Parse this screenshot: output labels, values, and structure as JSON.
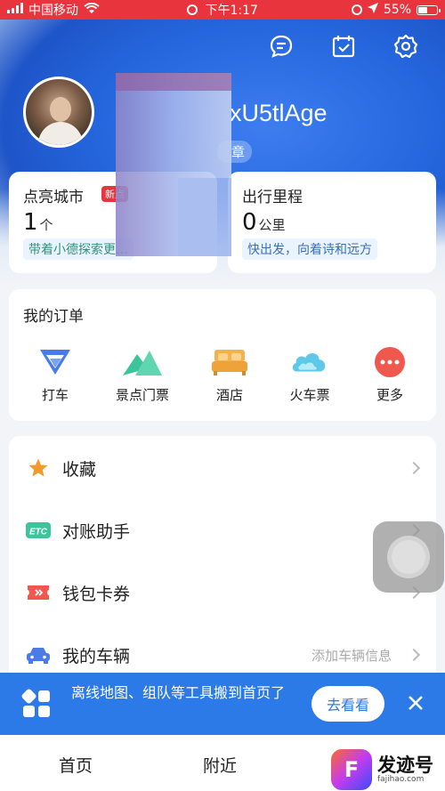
{
  "status_bar": {
    "carrier": "中国移动",
    "time": "下午1:17",
    "battery": "55%",
    "battery_level": 0.55
  },
  "header": {
    "username": "xU5tlAge",
    "badge": "章"
  },
  "stats": {
    "cities": {
      "title": "点亮城市",
      "tag": "新点",
      "value": "1",
      "unit": "个",
      "note": "带着小德探索更…"
    },
    "mileage": {
      "title": "出行里程",
      "value": "0",
      "unit": "公里",
      "note": "快出发，向着诗和远方"
    }
  },
  "orders": {
    "title": "我的订单",
    "items": [
      {
        "label": "打车",
        "icon": "taxi-icon"
      },
      {
        "label": "景点门票",
        "icon": "mountain-icon"
      },
      {
        "label": "酒店",
        "icon": "bed-icon"
      },
      {
        "label": "火车票",
        "icon": "cloud-icon"
      },
      {
        "label": "更多",
        "icon": "more-icon"
      }
    ]
  },
  "menu": {
    "items": [
      {
        "label": "收藏",
        "hint": "",
        "icon": "star-icon"
      },
      {
        "label": "对账助手",
        "hint": "",
        "icon": "etc-icon"
      },
      {
        "label": "钱包卡券",
        "hint": "",
        "icon": "ticket-icon"
      },
      {
        "label": "我的车辆",
        "hint": "添加车辆信息",
        "icon": "car-icon"
      }
    ]
  },
  "banner": {
    "text": "离线地图、组队等工具搬到首页了",
    "button": "去看看"
  },
  "tabbar": {
    "home": "首页",
    "nearby": "附近"
  },
  "watermark": {
    "text": "发迹号",
    "url": "fajihao.com"
  },
  "colors": {
    "status_red": "#e8343c",
    "brand_blue": "#2c7ae8",
    "header_blue": "#2566dd"
  }
}
